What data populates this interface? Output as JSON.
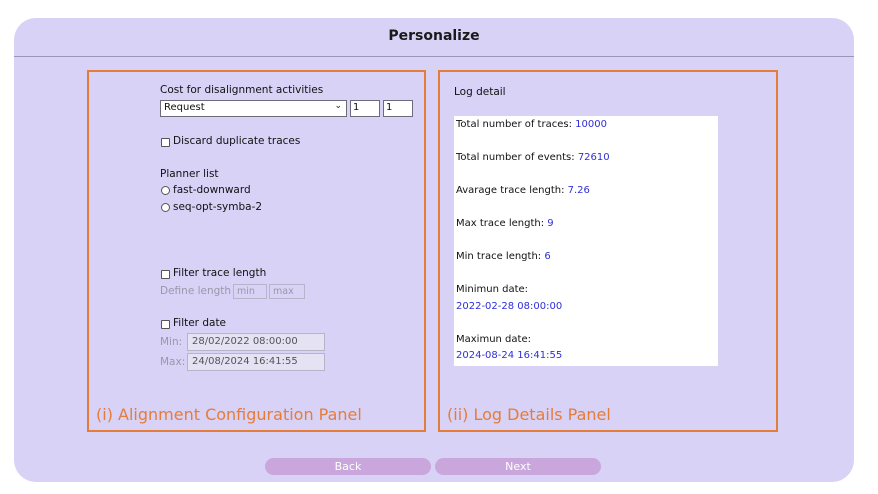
{
  "header": {
    "title": "Personalize"
  },
  "left_panel": {
    "caption": "(i) Alignment Configuration Panel",
    "cost_label": "Cost for disalignment activities",
    "cost_select": "Request",
    "cost_value_1": "1",
    "cost_value_2": "1",
    "discard_duplicates_label": "Discard duplicate traces",
    "planner_label": "Planner list",
    "planners": [
      "fast-downward",
      "seq-opt-symba-2"
    ],
    "filter_length_label": "Filter trace length",
    "define_length_label": "Define length",
    "min_placeholder": "min",
    "max_placeholder": "max",
    "filter_date_label": "Filter date",
    "min_date_label": "Min:",
    "min_date_value": "28/02/2022 08:00:00",
    "max_date_label": "Max:",
    "max_date_value": "24/08/2024 16:41:55"
  },
  "right_panel": {
    "caption": "(ii) Log Details Panel",
    "title": "Log detail",
    "stats": {
      "total_traces_label": "Total number of traces:",
      "total_traces": "10000",
      "total_events_label": "Total number of events:",
      "total_events": "72610",
      "avg_length_label": "Avarage trace length:",
      "avg_length": "7.26",
      "max_length_label": "Max trace length:",
      "max_length": "9",
      "min_length_label": "Min trace length:",
      "min_length": "6",
      "min_date_label": "Minimun date:",
      "min_date": "2022-02-28 08:00:00",
      "max_date_label": "Maximun date:",
      "max_date": "2024-08-24 16:41:55"
    }
  },
  "footer": {
    "back_label": "Back",
    "next_label": "Next"
  },
  "colors": {
    "card_bg": "#d7d2f6",
    "panel_border": "#e67c3a",
    "value_text": "#2f2fd8",
    "button_bg": "#c9a6dc"
  }
}
